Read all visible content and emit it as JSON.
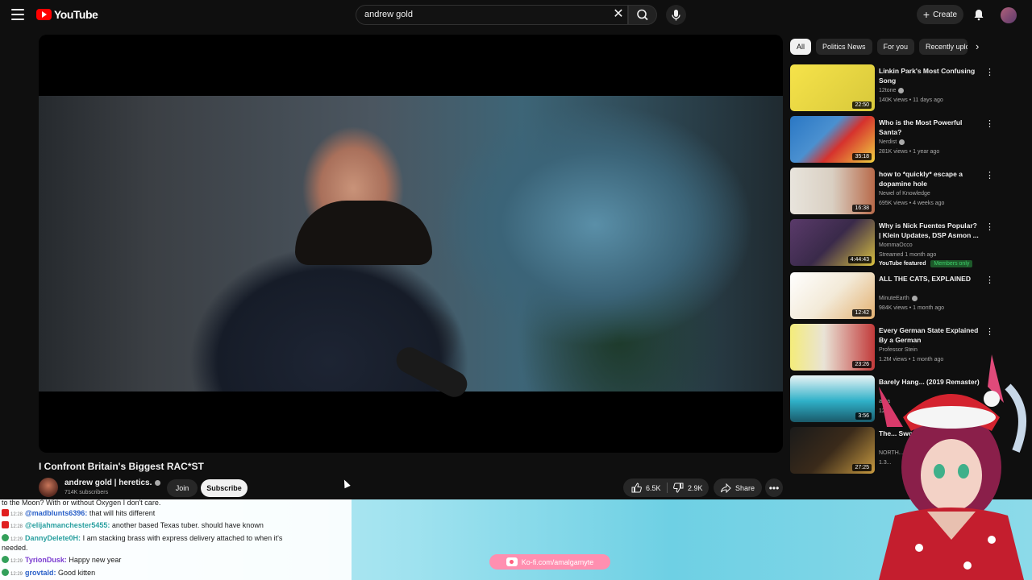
{
  "topbar": {
    "logo_text": "YouTube",
    "search_value": "andrew gold",
    "create_label": "Create"
  },
  "video": {
    "title": "I Confront Britain's Biggest RAC*ST",
    "channel": "andrew gold | heretics.",
    "subscribers": "714K subscribers",
    "join_label": "Join",
    "subscribe_label": "Subscribe",
    "likes": "6.5K",
    "dislikes": "2.9K",
    "share_label": "Share"
  },
  "chips": [
    "All",
    "Politics News",
    "For you",
    "Recently uploaded"
  ],
  "related": [
    {
      "title": "Linkin Park's Most Confusing Song",
      "channel": "12tone",
      "meta": "140K views • 11 days ago",
      "duration": "22:50",
      "thumb_colors": [
        "#f6e34a",
        "#d8c83a"
      ]
    },
    {
      "title": "Who is the Most Powerful Santa?",
      "channel": "Nerdist",
      "meta": "281K views • 1 year ago",
      "duration": "35:18",
      "thumb_colors": [
        "#2a77c4",
        "#d6322d"
      ]
    },
    {
      "title": "how to *quickly* escape a dopamine hole",
      "channel": "Newel of Knowledge",
      "meta": "695K views • 4 weeks ago",
      "duration": "16:38",
      "thumb_colors": [
        "#e8e4dc",
        "#b86a4a"
      ]
    },
    {
      "title": "Why is Nick Fuentes Popular? | Klein Updates, DSP Asmon ...",
      "channel": "MommaOcco",
      "meta": "Streamed 1 month ago",
      "duration": "4:44:43",
      "thumb_colors": [
        "#5a3a6a",
        "#d8c040"
      ]
    },
    {
      "title": "ALL THE CATS, EXPLAINED",
      "channel": "MinuteEarth",
      "meta": "984K views • 1 month ago",
      "duration": "12:42",
      "thumb_colors": [
        "#ffffff",
        "#e3b070"
      ]
    },
    {
      "title": "Every German State Explained By a German",
      "channel": "Professor Stein",
      "meta": "1.2M views • 1 month ago",
      "duration": "23:26",
      "thumb_colors": [
        "#e9e3d6",
        "#c23a3a"
      ]
    },
    {
      "title": "Barely Hang... (2019 Remaster)",
      "channel": "a-ha",
      "meta": "124K",
      "duration": "3:56",
      "thumb_colors": [
        "#2fb0c8",
        "#1a5a6a"
      ]
    },
    {
      "title": "The... Sword...",
      "channel": "NORTH...",
      "meta": "1.3...",
      "duration": "27:25",
      "thumb_colors": [
        "#1a1a1a",
        "#c89a40"
      ]
    }
  ],
  "related_badges": {
    "featured": "YouTube featured",
    "members": "Members only"
  },
  "chat": [
    {
      "time": "",
      "user": "",
      "text": "to the Moon? With or without Oxygen I don't care.",
      "src": "none"
    },
    {
      "time": "12:28",
      "user": "@madblunts6396:",
      "text": "that will hits different",
      "src": "yt"
    },
    {
      "time": "12:28",
      "user": "@elijahmanchester5455:",
      "text": "another based Texas tuber. should have known",
      "src": "yt"
    },
    {
      "time": "12:29",
      "user": "DannyDelete0H:",
      "text": "I am stacking brass with express delivery attached to when it's",
      "src": "tw"
    },
    {
      "time": "",
      "user": "",
      "text": "needed.",
      "src": "none"
    },
    {
      "time": "12:29",
      "user": "TyrionDusk:",
      "text": "Happy new year",
      "src": "tw"
    },
    {
      "time": "12:29",
      "user": "grovtald:",
      "text": "Good kitten",
      "src": "tw"
    }
  ],
  "kofi": "Ko-fi.com/amalgamyte",
  "colors": {
    "accent": "#ff0000",
    "bg": "#0f0f0f",
    "overlay": "#9fe2ef"
  }
}
